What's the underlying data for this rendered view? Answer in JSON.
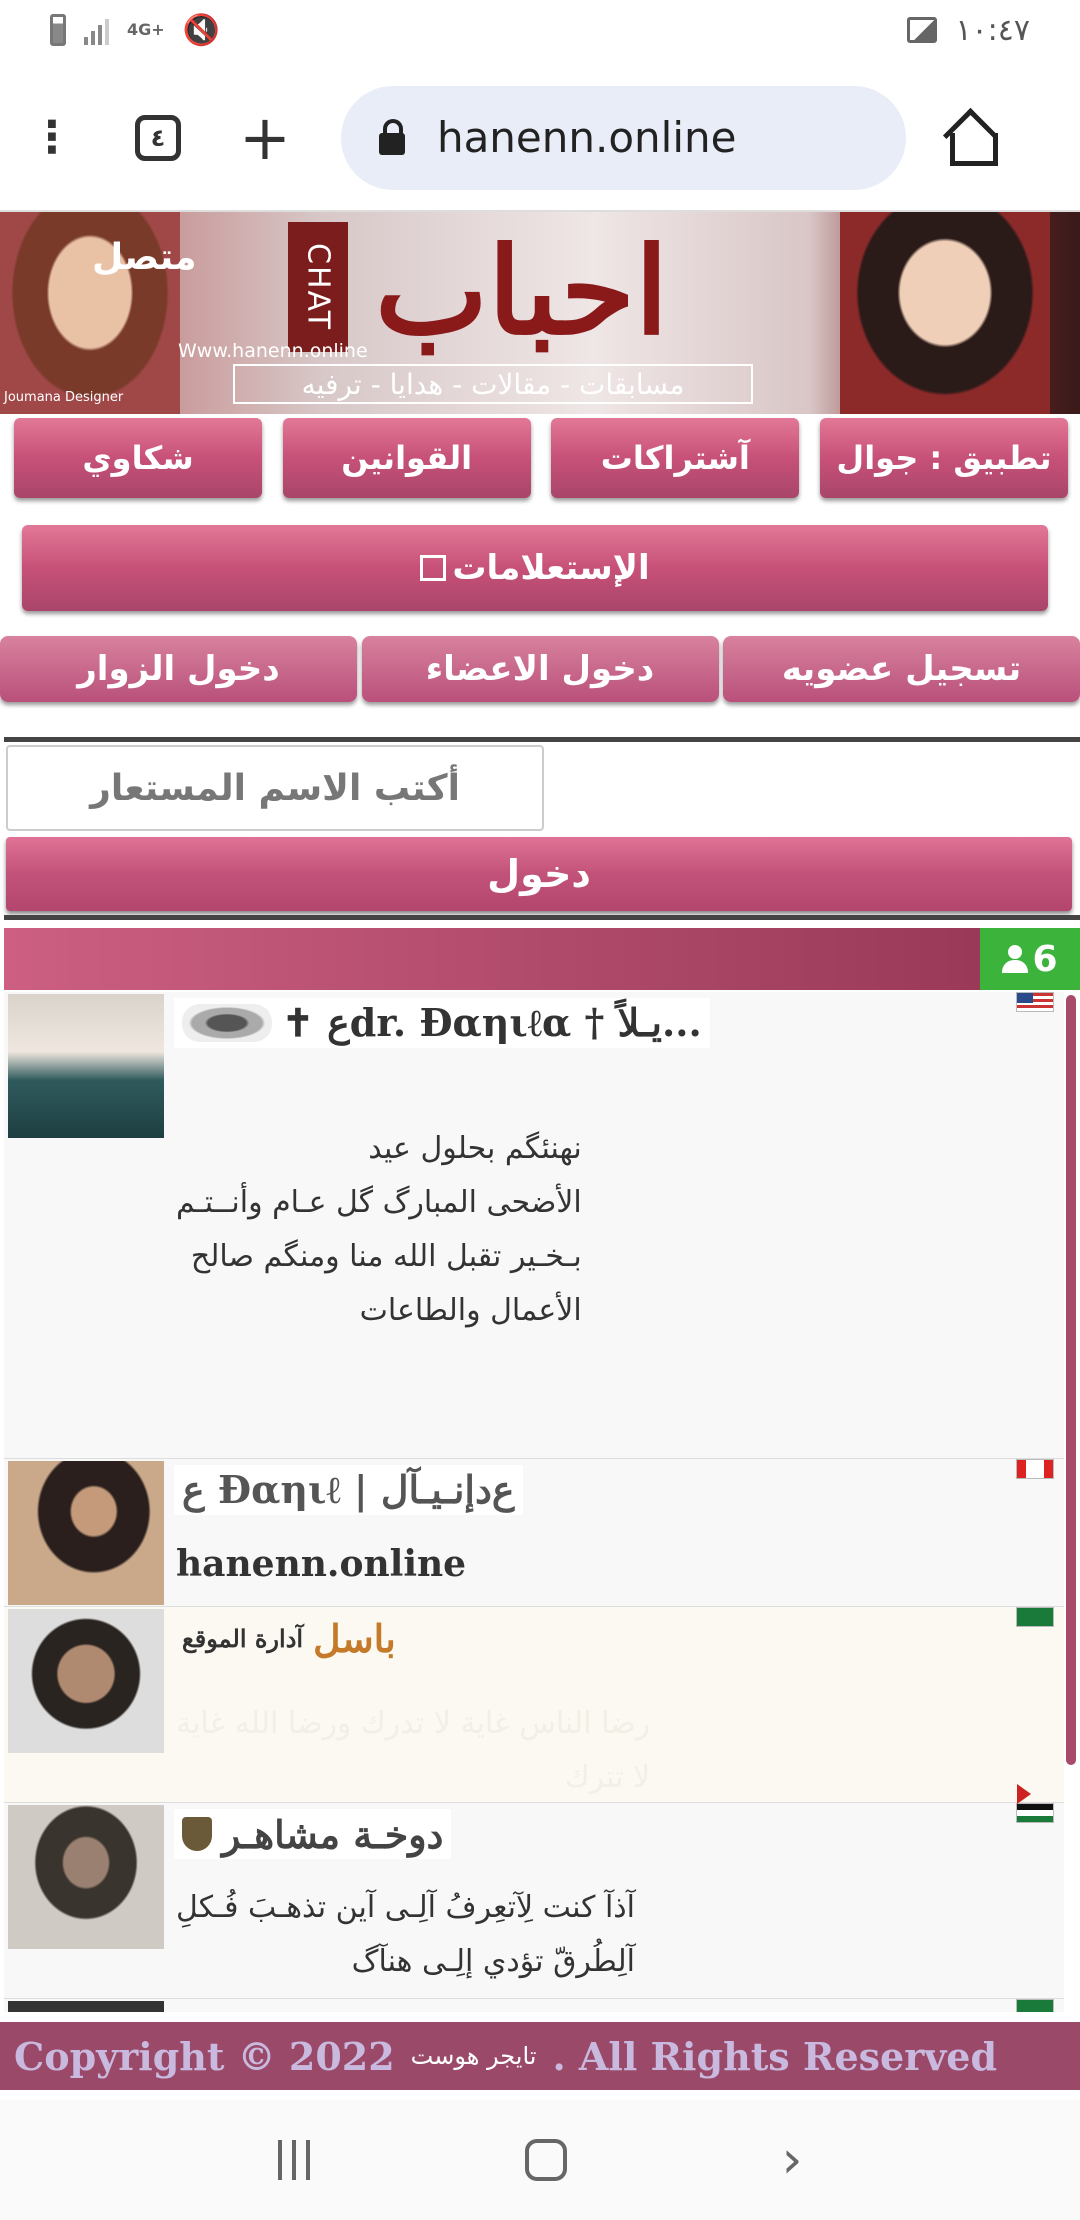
{
  "status_bar": {
    "network": "4G+",
    "time": "١٠:٤٧"
  },
  "browser": {
    "menu_icon": "more-vert-icon",
    "tab_count": "٤",
    "url": "hanenn.online"
  },
  "banner": {
    "online_text": "متصل",
    "chat_text": "CHAT",
    "logo_text": "احباب",
    "website": "Www.hanenn.online",
    "tagline": "مسابقات - مقالات - هدايا - ترفيه",
    "designer": "Joumana Designer"
  },
  "nav_buttons": [
    "تطبيق : جوال",
    "آشتراكات",
    "القوانين",
    "شكاوي"
  ],
  "queries_button": "الإستعلامات",
  "login_buttons": [
    "تسجيل عضويه",
    "دخول الاعضاء",
    "دخول الزوار"
  ],
  "name_placeholder": "أكتب الاسم المستعار",
  "enter_button": "دخول",
  "online_count": "6",
  "users": [
    {
      "name": "✝ ﻉdr. Ðαηιℓα † يـلاً...",
      "message": "نهنئگم بحلول عيد\nالأضحى المبارگ گل عـام وأنــتـم\nبـخـير تقبل الله منا ومنگم صالح\nالأعمال والطاعات",
      "flag": "us"
    },
    {
      "name": "ﻉ Ðαηιℓ | ﻉدإنـيـآل",
      "message": "hanenn.online",
      "flag": "ca"
    },
    {
      "role": "آدارة الموقع",
      "name": "باسل",
      "message": "رضا الناس غاية لا تدرك ورضا الله غاية\nلا تترك",
      "flag": "sa"
    },
    {
      "name": "دوخـة مشاهـر",
      "message": "آذآ كنت لِآتعِرفُ آلِـى آين تذهـبَ فُـكلِ\nآلِطُرقّ تؤدي إلِـى هنآگ",
      "flag": "jo"
    }
  ],
  "footer": {
    "copyright": "Copyright © 2022",
    "host": "تايجر هوست",
    "rights": ". All Rights Reserved"
  },
  "colors": {
    "primary_pink": "#c75178",
    "footer": "#9a4a68",
    "online_badge": "#3cb43c"
  }
}
